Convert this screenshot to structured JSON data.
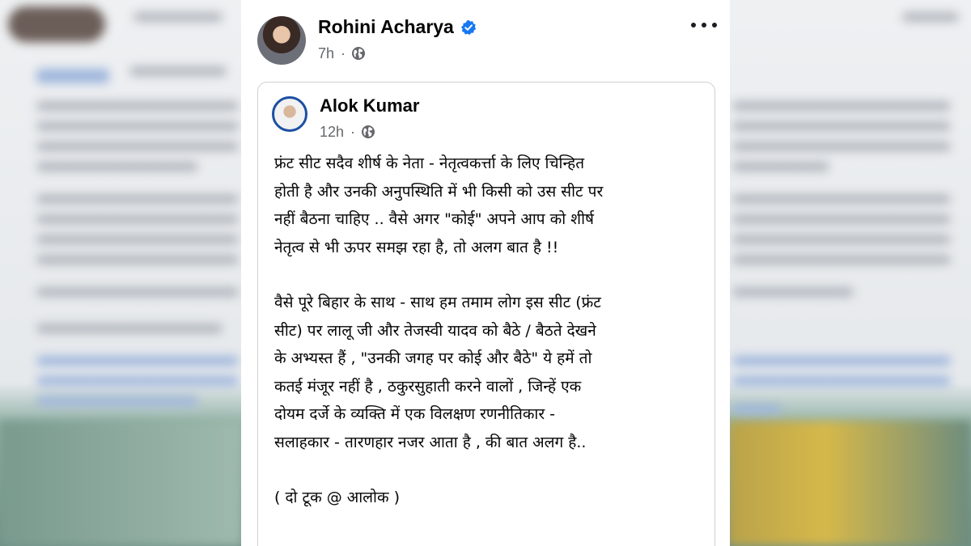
{
  "post": {
    "author": "Rohini Acharya",
    "time": "7h",
    "dot": "·",
    "icons": {
      "verified": "verified-badge-icon",
      "privacy": "globe-icon",
      "more": "more-options-icon"
    },
    "shared": {
      "author": "Alok Kumar",
      "time": "12h",
      "dot": "·",
      "paragraphs": [
        "फ्रंट सीट सदैव शीर्ष के नेता - नेतृत्वकर्त्ता के लिए चिन्हित\nहोती है और उनकी अनुपस्थिति में भी किसी को उस सीट पर\nनहीं बैठना चाहिए .. वैसे अगर \"कोई\" अपने आप को शीर्ष\nनेतृत्व से भी ऊपर समझ रहा है, तो अलग बात है !!",
        "वैसे पूरे बिहार के साथ - साथ हम तमाम लोग इस सीट (फ्रंट\nसीट) पर लालू जी और तेजस्वी यादव को बैठे / बैठते देखने\nके अभ्यस्त हैं , \"उनकी जगह पर कोई और बैठे\" ये हमें तो\nकतई मंजूर नहीं है , ठकुरसुहाती करने वालों , जिन्हें एक\nदोयम दर्जे के व्यक्ति में एक विलक्षण रणनीतिकार -\nसलाहकार - तारणहार नजर आता है , की बात अलग है..",
        "( दो टूक @ आलोक )"
      ]
    }
  },
  "colors": {
    "verified_blue": "#1877f2",
    "meta_gray": "#65676b",
    "text": "#050505",
    "card_border": "#ced0d4"
  }
}
